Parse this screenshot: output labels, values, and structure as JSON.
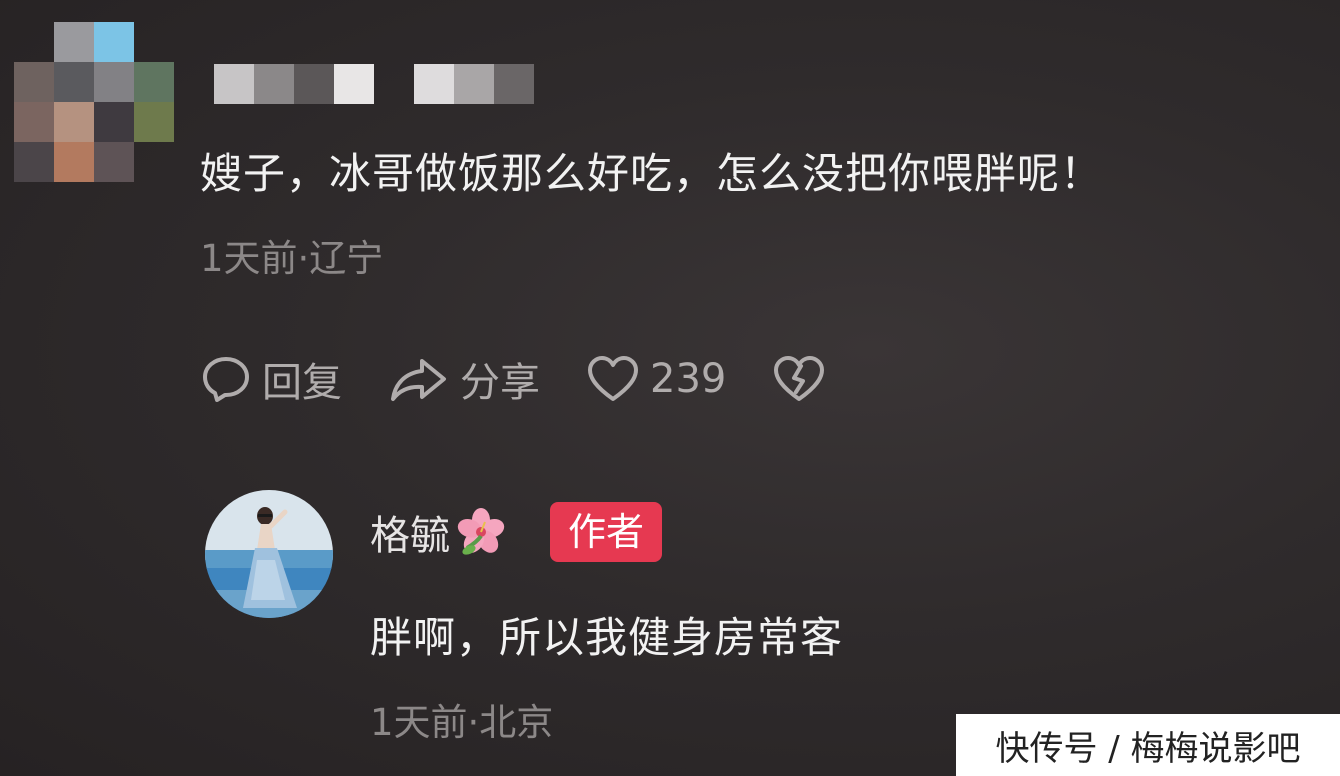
{
  "comment": {
    "text": "嫂子，冰哥做饭那么好吃，怎么没把你喂胖呢！",
    "meta": "1天前·辽宁",
    "actions": {
      "reply_label": "回复",
      "share_label": "分享",
      "like_count": "239"
    },
    "icons": {
      "reply": "comment-bubble-icon",
      "share": "share-arrow-icon",
      "like": "heart-icon",
      "dislike": "broken-heart-icon"
    }
  },
  "reply": {
    "author_name": "格毓",
    "author_badge": "作者",
    "text": "胖啊，所以我健身房常客",
    "meta": "1天前·北京",
    "badge_color": "#e63951",
    "name_decoration": "hibiscus-flower-icon"
  },
  "watermark": {
    "text": "快传号 / 梅梅说影吧"
  },
  "colors": {
    "background": "#2f2b2c",
    "text_primary": "#f2f2f2",
    "text_secondary": "#8c8888",
    "action_gray": "#b0acac"
  }
}
